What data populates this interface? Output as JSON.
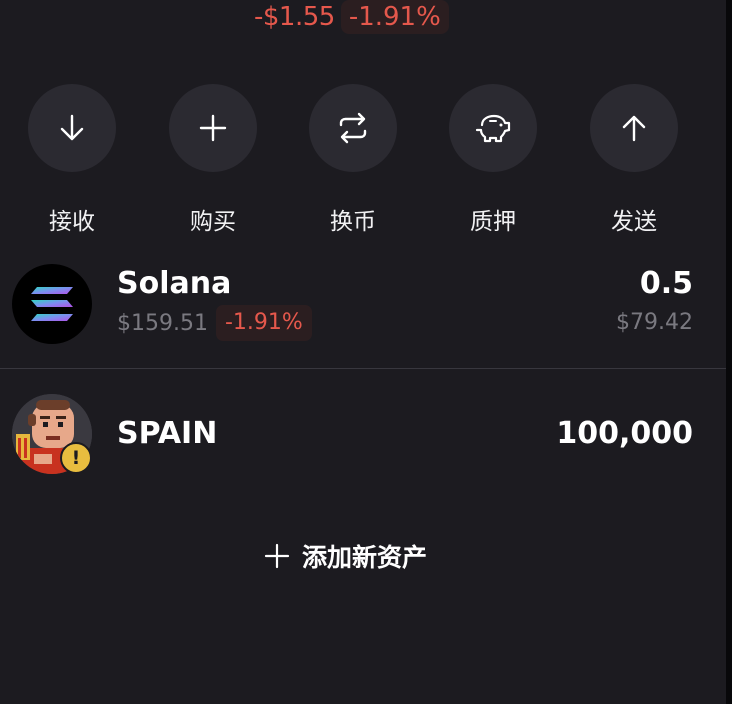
{
  "header": {
    "change_amount": "-$1.55",
    "change_percent": "-1.91%"
  },
  "actions": [
    {
      "label": "接收",
      "icon": "arrow-down-icon"
    },
    {
      "label": "购买",
      "icon": "plus-icon"
    },
    {
      "label": "换币",
      "icon": "swap-icon"
    },
    {
      "label": "质押",
      "icon": "piggy-bank-icon"
    },
    {
      "label": "发送",
      "icon": "arrow-up-icon"
    }
  ],
  "assets": [
    {
      "name": "Solana",
      "price": "$159.51",
      "change": "-1.91%",
      "amount": "0.5",
      "value": "$79.42",
      "icon": "solana-logo-icon"
    },
    {
      "name": "SPAIN",
      "amount": "100,000",
      "icon": "spain-token-avatar",
      "badge": "!"
    }
  ],
  "add_asset": {
    "label": "添加新资产",
    "icon": "plus-icon"
  },
  "colors": {
    "background": "#1c1b20",
    "button_bg": "#2b2a31",
    "negative": "#e5584c",
    "muted": "#7a7980",
    "warning": "#e8bd3f"
  }
}
